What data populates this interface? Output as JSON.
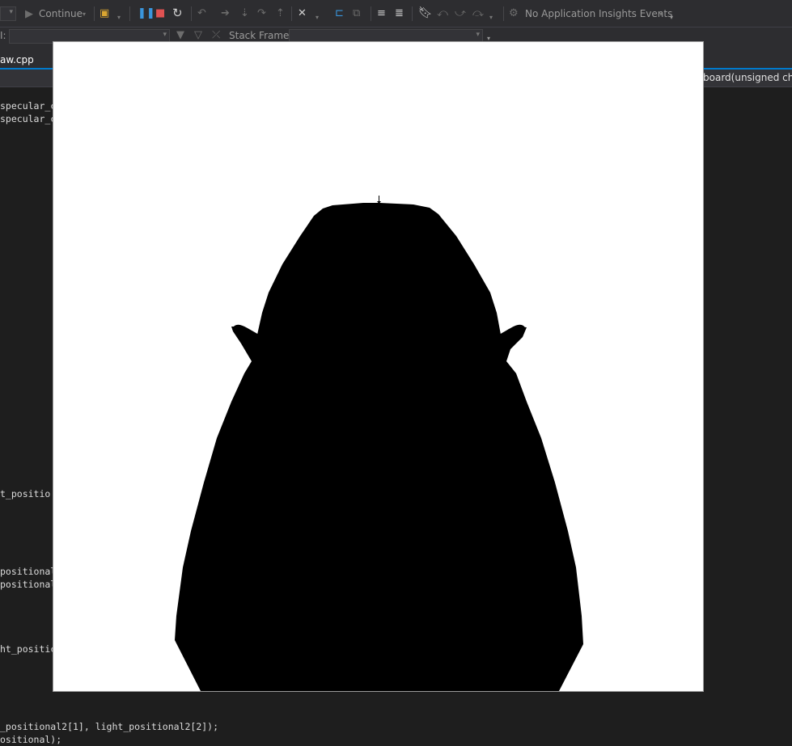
{
  "toolbar": {
    "continue_label": "Continue",
    "insights_label": "No Application Insights Events"
  },
  "debug_location": {
    "stack_frame_label": "Stack Frame:",
    "thread_label": "I:"
  },
  "tabs": {
    "active_file": "aw.cpp"
  },
  "navbar": {
    "function_name": "board(unsigned char"
  },
  "code_lines": {
    "line1": "specular_c",
    "line2": "specular_c",
    "line3": "t_positio",
    "line4": "positional",
    "line5": "positional",
    "line6": "ht_positic",
    "line7": "_positional2[1], light_positional2[2]);",
    "line8": "ositional);"
  },
  "colors": {
    "ide_background": "#1e1e1e",
    "toolbar_background": "#2d2d30",
    "accent_blue": "#007acc",
    "render_background": "#ffffff",
    "silhouette": "#000000"
  }
}
